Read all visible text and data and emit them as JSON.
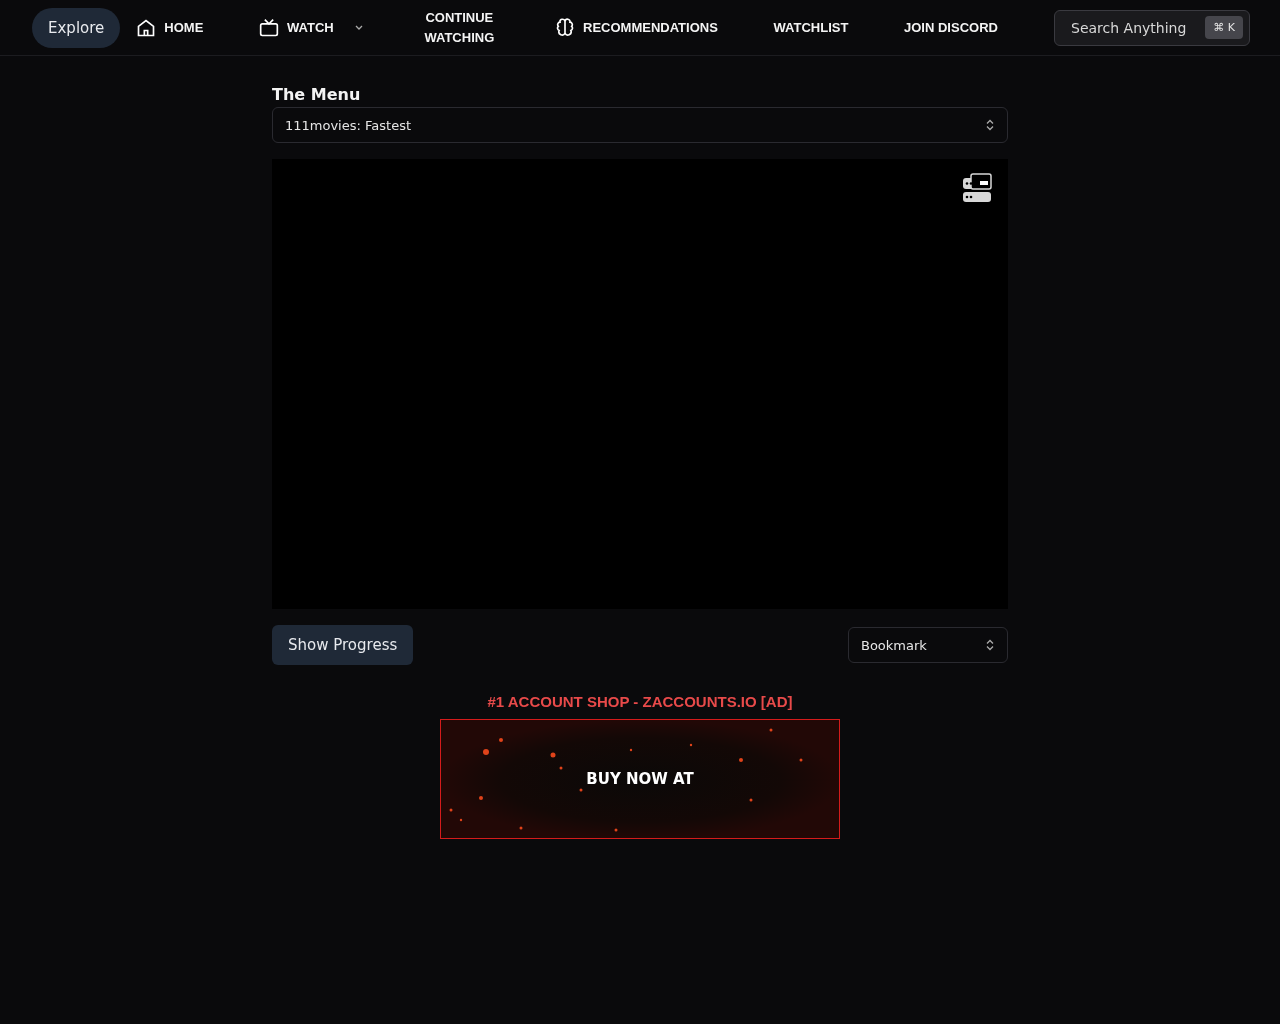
{
  "nav": {
    "explore": {
      "label": "Explore",
      "selected": true
    },
    "items": [
      {
        "label": "HOME",
        "kind": "icon"
      },
      {
        "label": "WATCH",
        "kind": "dropdown"
      },
      {
        "label": "CONTINUE WATCHING",
        "kind": "plain"
      },
      {
        "label": "RECOMMENDATIONS",
        "kind": "icon"
      },
      {
        "label": "WATCHLIST",
        "kind": "plain"
      },
      {
        "label": "JOIN DISCORD",
        "kind": "plain"
      }
    ],
    "search": {
      "placeholder": "Search Anything",
      "shortcut": "⌘ K"
    }
  },
  "menu": {
    "title": "The Menu",
    "source": "111movies: Fastest"
  },
  "controls": {
    "show_progress": "Show Progress",
    "bookmark": "Bookmark"
  },
  "ad": {
    "title": "#1 ACCOUNT SHOP - ZACCOUNTS.IO [AD]",
    "banner_text": "BUY NOW AT"
  }
}
